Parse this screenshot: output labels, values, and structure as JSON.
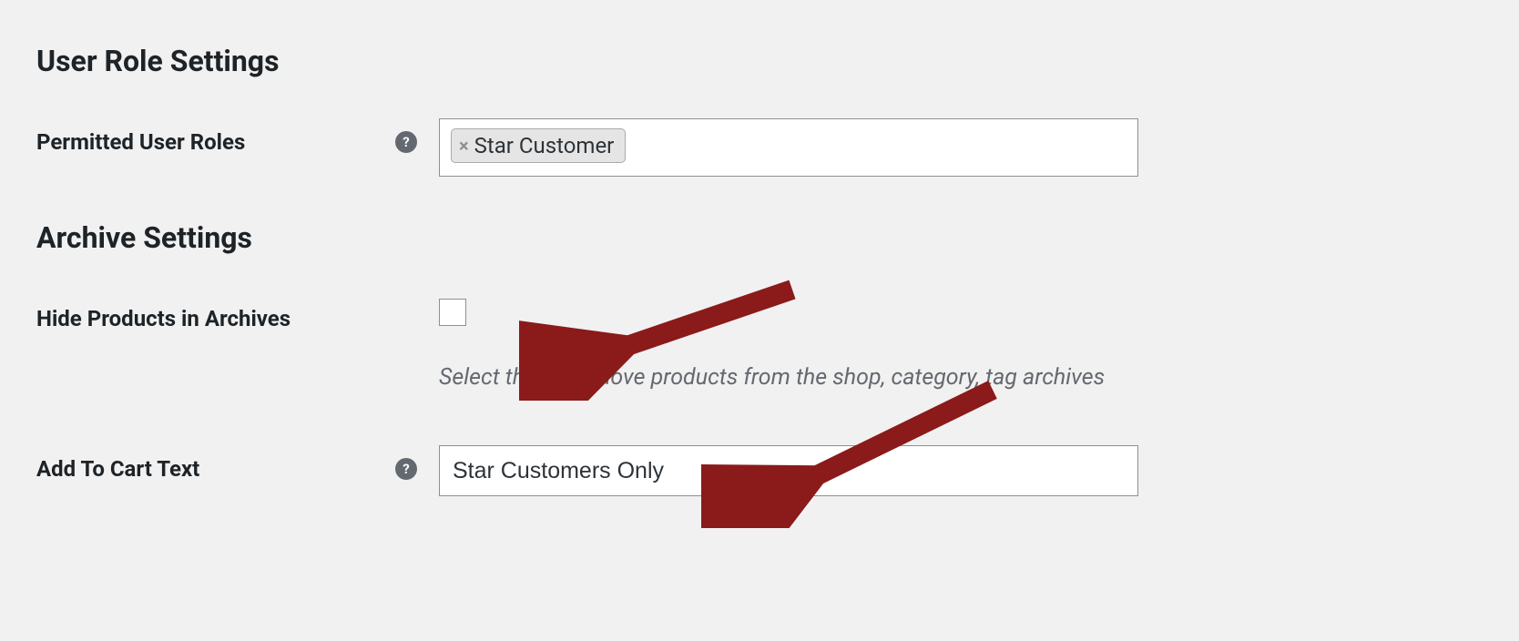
{
  "sections": {
    "userRoleSettings": {
      "title": "User Role Settings",
      "permittedUserRoles": {
        "label": "Permitted User Roles",
        "tags": [
          "Star Customer"
        ]
      }
    },
    "archiveSettings": {
      "title": "Archive Settings",
      "hideInArchives": {
        "label": "Hide Products in Archives",
        "checked": false,
        "description": "Select this to remove products from the shop, category, tag archives"
      },
      "addToCartText": {
        "label": "Add To Cart Text",
        "value": "Star Customers Only"
      }
    }
  },
  "helpGlyph": "?",
  "removeGlyph": "×",
  "annotations": {
    "arrowColor": "#8b1a1a"
  }
}
